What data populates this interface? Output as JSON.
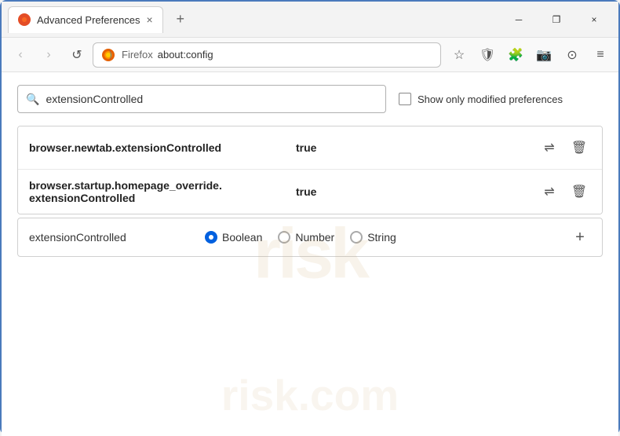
{
  "window": {
    "title": "Advanced Preferences",
    "tab_close": "×",
    "new_tab": "+",
    "wc_minimize": "─",
    "wc_restore": "❐",
    "wc_close": "×"
  },
  "nav": {
    "back": "‹",
    "forward": "›",
    "reload": "↺",
    "site_name": "Firefox",
    "address": "about:config",
    "bookmark_icon": "☆",
    "shield_icon": "🛡",
    "ext_icon": "🧩",
    "camera_icon": "📷",
    "account_icon": "⊙",
    "menu_icon": "≡"
  },
  "content": {
    "watermark_top": "risk",
    "watermark_bottom": "risk.com",
    "search": {
      "placeholder": "extensionControlled",
      "value": "extensionControlled"
    },
    "checkbox": {
      "label": "Show only modified preferences",
      "checked": false
    },
    "results": [
      {
        "name": "browser.newtab.extensionControlled",
        "value": "true",
        "toggle_title": "Toggle",
        "delete_title": "Delete"
      },
      {
        "name": "browser.startup.homepage_override.\nextensionControlled",
        "name_line1": "browser.startup.homepage_override.",
        "name_line2": "extensionControlled",
        "value": "true",
        "toggle_title": "Toggle",
        "delete_title": "Delete"
      }
    ],
    "new_pref": {
      "name": "extensionControlled",
      "types": [
        {
          "label": "Boolean",
          "selected": true
        },
        {
          "label": "Number",
          "selected": false
        },
        {
          "label": "String",
          "selected": false
        }
      ],
      "add_label": "+"
    }
  }
}
